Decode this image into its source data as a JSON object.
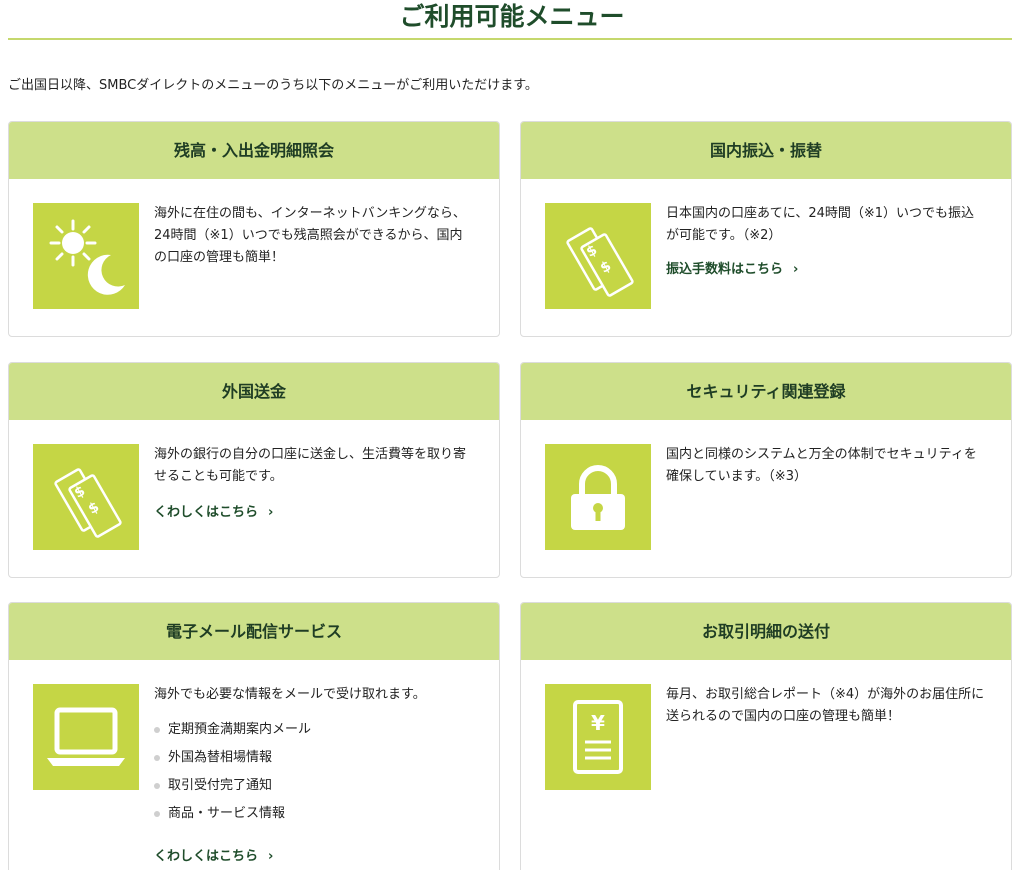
{
  "header": {
    "title": "ご利用可能メニュー"
  },
  "intro": "ご出国日以降、SMBCダイレクトのメニューのうち以下のメニューがご利用いただけます。",
  "cards": [
    {
      "title": "残高・入出金明細照会",
      "icon": "sun-moon-icon",
      "text": "海外に在住の間も、インターネットバンキングなら、24時間（※1）いつでも残高照会ができるから、国内の口座の管理も簡単！"
    },
    {
      "title": "国内振込・振替",
      "icon": "banknotes-icon",
      "text": "日本国内の口座あてに、24時間（※1）いつでも振込が可能です。（※2）",
      "link": "振込手数料はこちら"
    },
    {
      "title": "外国送金",
      "icon": "banknotes-icon",
      "text": "海外の銀行の自分の口座に送金し、生活費等を取り寄せることも可能です。",
      "link": "くわしくはこちら"
    },
    {
      "title": "セキュリティ関連登録",
      "icon": "padlock-icon",
      "text": "国内と同様のシステムと万全の体制でセキュリティを確保しています。（※3）"
    },
    {
      "title": "電子メール配信サービス",
      "icon": "laptop-icon",
      "text": "海外でも必要な情報をメールで受け取れます。",
      "bullets": [
        "定期預金満期案内メール",
        "外国為替相場情報",
        "取引受付完了通知",
        "商品・サービス情報"
      ],
      "link": "くわしくはこちら"
    },
    {
      "title": "お取引明細の送付",
      "icon": "yen-statement-icon",
      "text": "毎月、お取引総合レポート（※4）が海外のお届住所に送られるので国内の口座の管理も簡単！"
    }
  ],
  "chevron": "›",
  "colors": {
    "accent": "#c5d645",
    "header_bg": "#cde08a",
    "title": "#1f4d2b",
    "rule": "#c5d86d"
  }
}
